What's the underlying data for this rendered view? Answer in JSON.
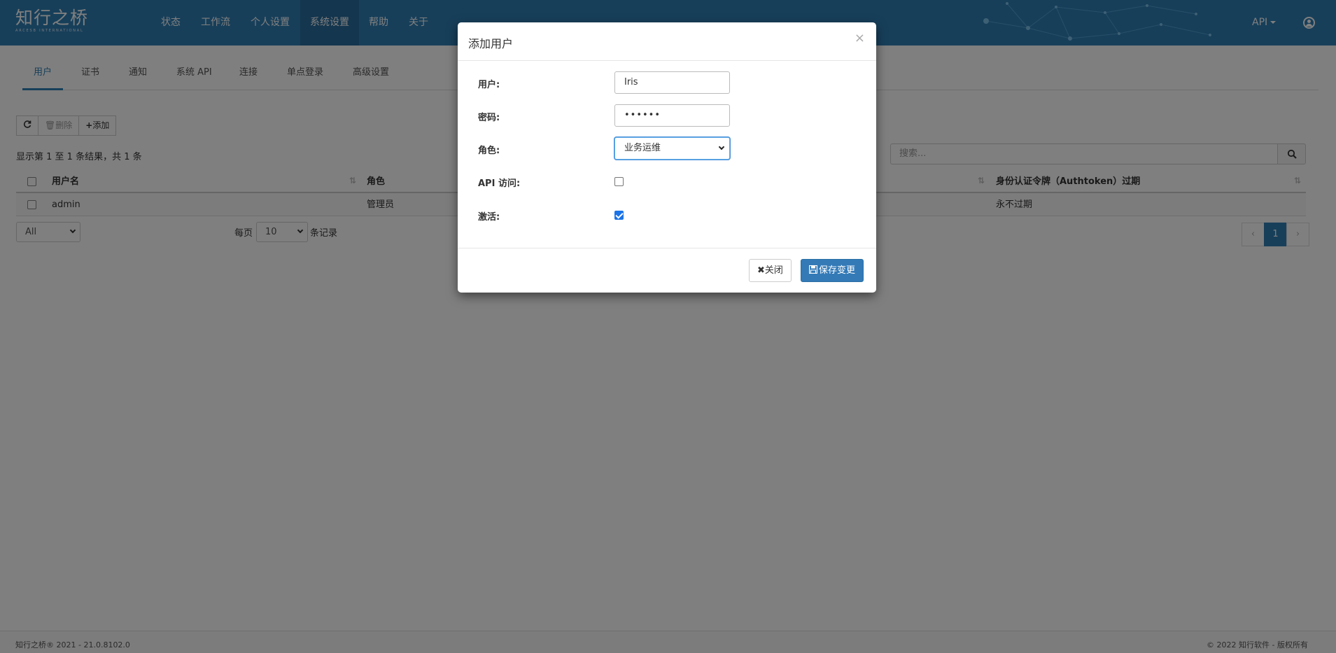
{
  "brand": {
    "name": "知行之桥",
    "subtitle": "ARCESB INTERNATIONAL"
  },
  "nav": {
    "items": [
      {
        "label": "状态"
      },
      {
        "label": "工作流"
      },
      {
        "label": "个人设置"
      },
      {
        "label": "系统设置",
        "active": true
      },
      {
        "label": "帮助"
      },
      {
        "label": "关于"
      }
    ],
    "api_label": "API"
  },
  "tabs": [
    {
      "label": "用户",
      "active": true
    },
    {
      "label": "证书"
    },
    {
      "label": "通知"
    },
    {
      "label": "系统 API"
    },
    {
      "label": "连接"
    },
    {
      "label": "单点登录"
    },
    {
      "label": "高级设置"
    }
  ],
  "toolbar": {
    "refresh_icon": "refresh-icon",
    "delete_label": "删除",
    "add_label": "添加"
  },
  "summary_text": "显示第 1 至 1 条结果，共 1 条",
  "search": {
    "placeholder": "搜索..."
  },
  "table": {
    "columns": [
      "用户名",
      "角色",
      "身份认证令牌（Authtoken）过期"
    ],
    "rows": [
      {
        "username": "admin",
        "role": "管理员",
        "expiry": "永不过期"
      }
    ]
  },
  "footer_controls": {
    "filter_value": "All",
    "per_page_prefix": "每页",
    "per_page_value": "10",
    "per_page_suffix": "条记录",
    "pager": {
      "prev": "‹",
      "current": "1",
      "next": "›"
    }
  },
  "page_footer": {
    "left": "知行之桥® 2021 - 21.0.8102.0",
    "right": "© 2022 知行软件 - 版权所有"
  },
  "modal": {
    "title": "添加用户",
    "close_glyph": "×",
    "fields": {
      "user_label": "用户:",
      "user_value": "Iris",
      "password_label": "密码:",
      "password_value": "••••••",
      "role_label": "角色:",
      "role_value": "业务运维",
      "api_label": "API 访问:",
      "api_checked": false,
      "active_label": "激活:",
      "active_checked": true
    },
    "close_button": "关闭",
    "save_button": "保存变更"
  },
  "colors": {
    "primary": "#2f7fb5",
    "navbar": "#2f7fb5",
    "checkbox_checked": "#1a73e8"
  }
}
